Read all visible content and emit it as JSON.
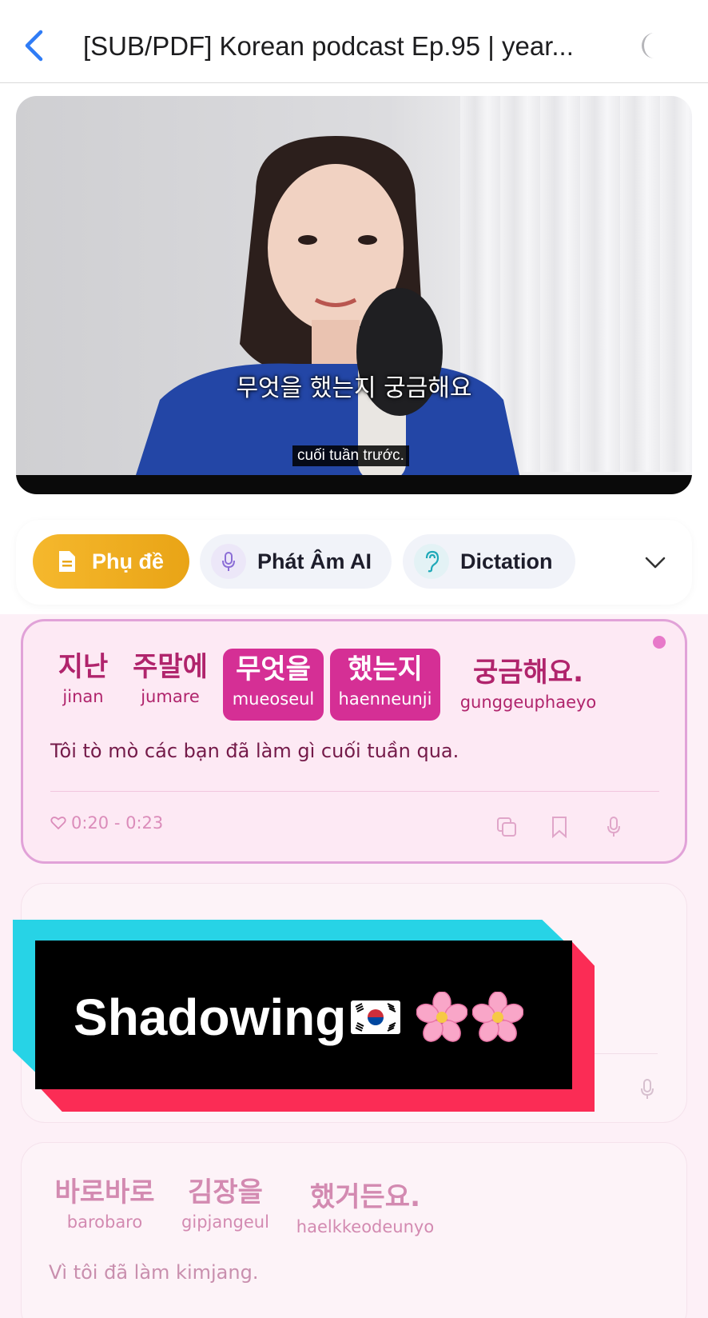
{
  "header": {
    "title": "[SUB/PDF] Korean podcast Ep.95 | year...",
    "back_icon": "chevron-left-icon",
    "theme_icon": "moon-icon"
  },
  "video": {
    "subtitle_korean": "무엇을 했는지 궁금해요",
    "subtitle_translation": "cuối tuần trước."
  },
  "tabs": [
    {
      "label": "Phụ đề",
      "icon": "document-icon",
      "active": true
    },
    {
      "label": "Phát Âm AI",
      "icon": "microphone-icon",
      "active": false
    },
    {
      "label": "Dictation",
      "icon": "ear-icon",
      "active": false
    }
  ],
  "card1": {
    "words": [
      {
        "ko": "지난",
        "rom": "jinan",
        "highlight": false
      },
      {
        "ko": "주말에",
        "rom": "jumare",
        "highlight": false
      },
      {
        "ko": "무엇을",
        "rom": "mueoseul",
        "highlight": true
      },
      {
        "ko": "했는지",
        "rom": "haenneunji",
        "highlight": true
      },
      {
        "ko": "궁금해요.",
        "rom": "gunggeuphaeyo",
        "highlight": false
      }
    ],
    "translation": "Tôi tò mò các bạn đã làm gì cuối tuần qua.",
    "time": "0:20 - 0:23"
  },
  "banner": {
    "text": "Shadowing"
  },
  "card3": {
    "words": [
      {
        "ko": "바로바로",
        "rom": "barobaro"
      },
      {
        "ko": "김장을",
        "rom": "gipjangeul"
      },
      {
        "ko": "했거든요.",
        "rom": "haelkkeodeunyo"
      }
    ],
    "translation": "Vì tôi đã làm kimjang."
  },
  "colors": {
    "accent_pink": "#d52f95",
    "active_tab": "#f5b82d",
    "ios_blue": "#2f7cf6"
  }
}
